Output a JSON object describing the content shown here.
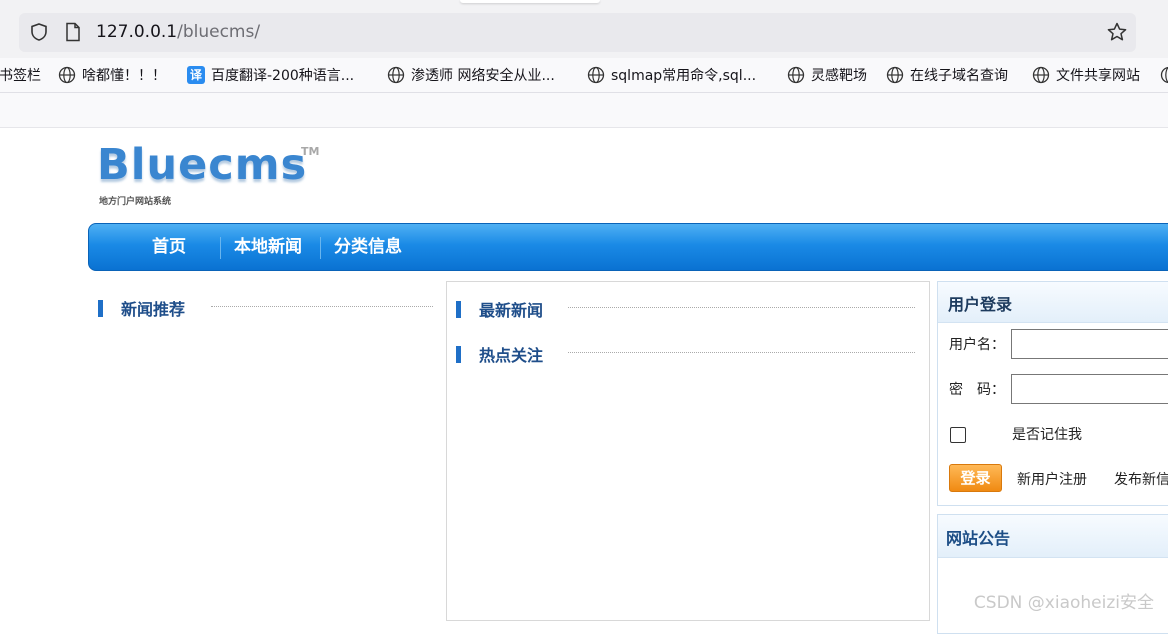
{
  "browser": {
    "url_host": "127.0.0.1",
    "url_path": "/bluecms/",
    "bookmarks": [
      {
        "label": "书签栏",
        "icon": "none"
      },
      {
        "label": "啥都懂！！！",
        "icon": "globe-icon"
      },
      {
        "label": "百度翻译-200种语言...",
        "icon": "translate-icon",
        "icon_text": "译"
      },
      {
        "label": "渗透师 网络安全从业...",
        "icon": "globe-icon"
      },
      {
        "label": "sqlmap常用命令,sql...",
        "icon": "globe-icon"
      },
      {
        "label": "灵感靶场",
        "icon": "globe-icon"
      },
      {
        "label": "在线子域名查询",
        "icon": "globe-icon"
      },
      {
        "label": "文件共享网站",
        "icon": "globe-icon"
      }
    ]
  },
  "site": {
    "logo_text": "Bluecms",
    "logo_tm": "TM",
    "logo_subtitle": "地方门户网站系统"
  },
  "nav": {
    "items": [
      "首页",
      "本地新闻",
      "分类信息"
    ]
  },
  "sections": {
    "recommended": "新闻推荐",
    "latest": "最新新闻",
    "hot": "热点关注"
  },
  "login": {
    "title": "用户登录",
    "username_label": "用户名：",
    "password_label": "密　码：",
    "remember_label": "是否记住我",
    "login_button": "登录",
    "register_link": "新用户注册",
    "publish_link": "发布新信"
  },
  "notice": {
    "title": "网站公告"
  },
  "watermark": "CSDN @xiaoheizi安全",
  "colors": {
    "nav_blue": "#1a8ae6",
    "section_title": "#1f4e8a",
    "login_button": "#f08a12"
  }
}
